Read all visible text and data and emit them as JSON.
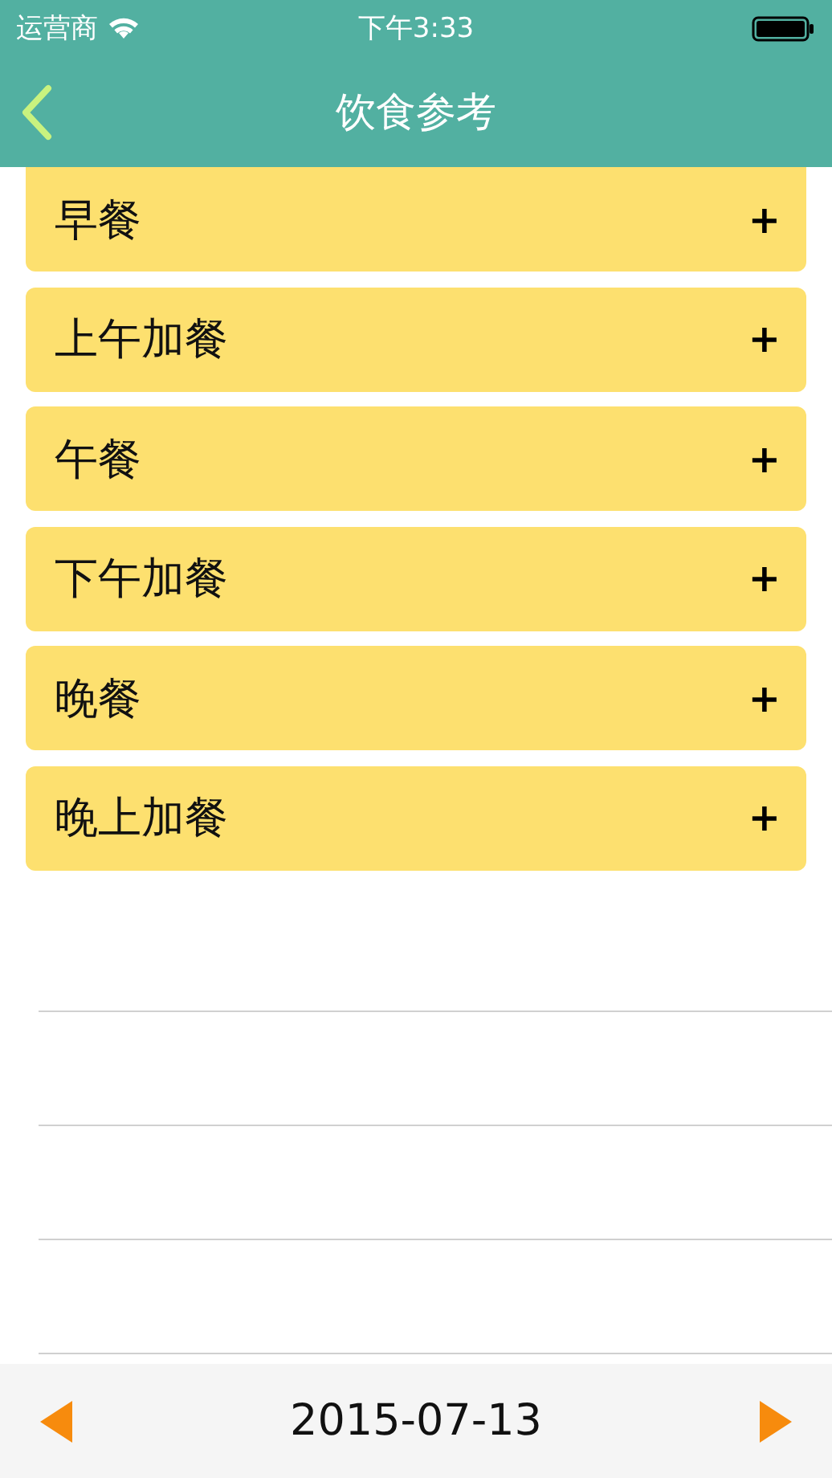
{
  "status_bar": {
    "carrier": "运营商",
    "time": "下午3:33"
  },
  "nav": {
    "title": "饮食参考"
  },
  "meals": [
    {
      "label": "早餐",
      "action": "+"
    },
    {
      "label": "上午加餐",
      "action": "+"
    },
    {
      "label": "午餐",
      "action": "+"
    },
    {
      "label": "下午加餐",
      "action": "+"
    },
    {
      "label": "晚餐",
      "action": "+"
    },
    {
      "label": "晚上加餐",
      "action": "+"
    }
  ],
  "date_bar": {
    "date": "2015-07-13"
  }
}
